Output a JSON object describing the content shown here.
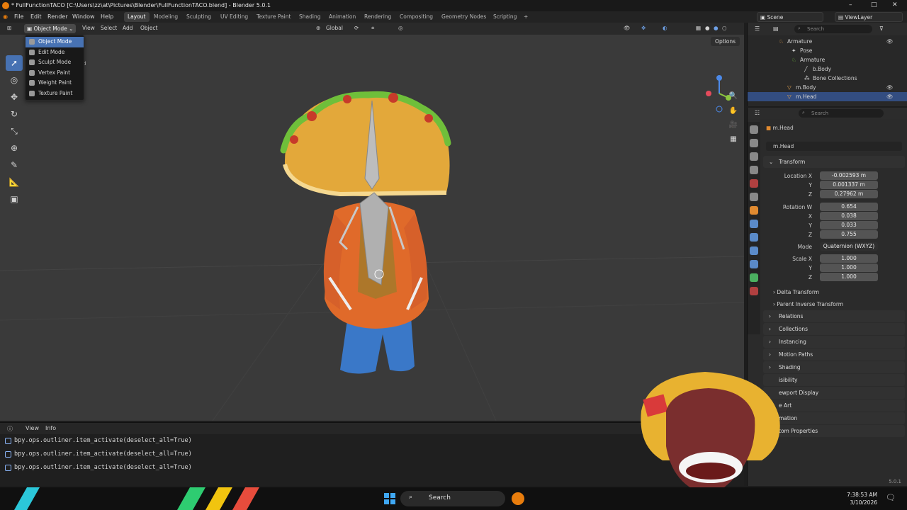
{
  "window": {
    "title": "* FullFunctionTACO [C:\\Users\\zz\\at\\Pictures\\Blender\\FullFunctionTACO.blend] - Blender 5.0.1",
    "controls": [
      "–",
      "□",
      "✕"
    ]
  },
  "menubar": {
    "items": [
      "File",
      "Edit",
      "Render",
      "Window",
      "Help"
    ]
  },
  "workspaces": {
    "tabs": [
      "Layout",
      "Modeling",
      "Sculpting",
      "UV Editing",
      "Texture Paint",
      "Shading",
      "Animation",
      "Rendering",
      "Compositing",
      "Geometry Nodes",
      "Scripting"
    ],
    "active": "Layout",
    "add": "+"
  },
  "scene": {
    "scene_name": "Scene",
    "view_layer": "ViewLayer"
  },
  "viewport": {
    "mode_label": "Object Mode",
    "header_menus": [
      "View",
      "Select",
      "Add",
      "Object"
    ],
    "orientation": "Global",
    "options_label": "Options",
    "partial_overlay_text": "d"
  },
  "mode_dropdown": {
    "items": [
      "Object Mode",
      "Edit Mode",
      "Sculpt Mode",
      "Vertex Paint",
      "Weight Paint",
      "Texture Paint"
    ],
    "selected": "Object Mode"
  },
  "console": {
    "menus": [
      "View",
      "Info"
    ],
    "lines": [
      "bpy.ops.outliner.item_activate(deselect_all=True)",
      "bpy.ops.outliner.item_activate(deselect_all=True)",
      "bpy.ops.outliner.item_activate(deselect_all=True)"
    ]
  },
  "outliner": {
    "search_placeholder": "Search",
    "rows": [
      "Armature",
      "Pose",
      "Armature",
      "b.Body",
      "Bone Collections",
      "m.Body",
      "m.Head"
    ],
    "selected": "m.Head"
  },
  "properties": {
    "search_placeholder": "Search",
    "object_name": "m.Head",
    "data_name": "m.Head",
    "transform_header": "Transform",
    "location": {
      "label_x": "Location X",
      "label_y": "Y",
      "label_z": "Z",
      "x": "-0.002593 m",
      "y": "0.001337 m",
      "z": "0.27962 m"
    },
    "rotation": {
      "label_w": "Rotation W",
      "label_x": "X",
      "label_y": "Y",
      "label_z": "Z",
      "w": "0.654",
      "x": "0.038",
      "y": "0.033",
      "z": "0.755"
    },
    "mode": {
      "label": "Mode",
      "value": "Quaternion (WXYZ)"
    },
    "scale": {
      "label_x": "Scale X",
      "label_y": "Y",
      "label_z": "Z",
      "x": "1.000",
      "y": "1.000",
      "z": "1.000"
    },
    "subpanels": [
      "Delta Transform",
      "Parent Inverse Transform"
    ],
    "panels": [
      "Relations",
      "Collections",
      "Instancing",
      "Motion Paths",
      "Shading",
      "isibility",
      "ewport Display",
      "e Art",
      "mation",
      "tom Properties"
    ]
  },
  "taskbar": {
    "search_label": "Search",
    "time": "7:38:53 AM",
    "date": "3/10/2026"
  },
  "status": {
    "version": "5.0.1"
  },
  "colors": {
    "accent_blue": "#4772b3",
    "taco_shell": "#e3a83a",
    "hoodie": "#e06a2a",
    "jeans": "#3a78c8",
    "bone": "#bdbdbd"
  }
}
